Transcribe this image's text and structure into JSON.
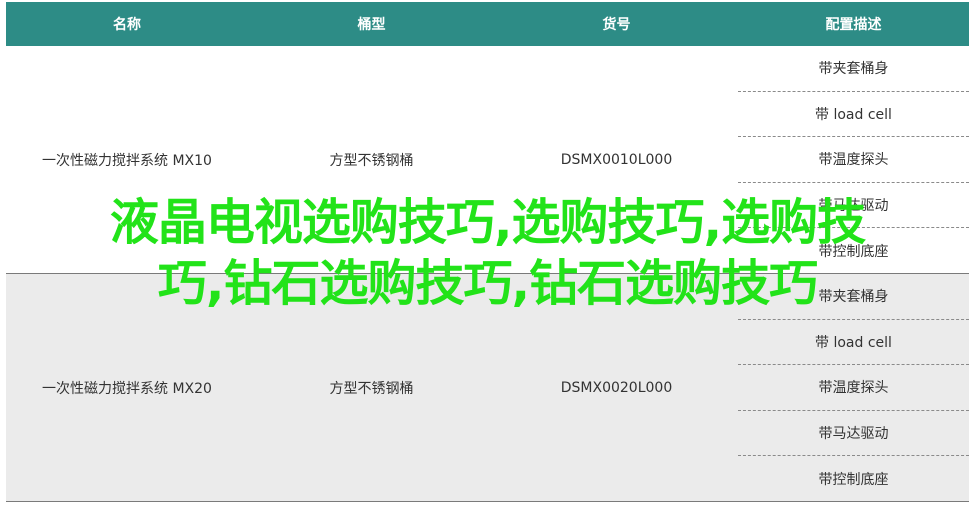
{
  "table": {
    "headers": [
      "名称",
      "桶型",
      "货号",
      "配置描述"
    ],
    "groups": [
      {
        "name": "一次性磁力搅拌系统 MX10",
        "barrel": "方型不锈钢桶",
        "sku": "DSMX0010L000",
        "configs": [
          "带夹套桶身",
          "带 load cell",
          "带温度探头",
          "带马达驱动",
          "带控制底座"
        ]
      },
      {
        "name": "一次性磁力搅拌系统 MX20",
        "barrel": "方型不锈钢桶",
        "sku": "DSMX0020L000",
        "configs": [
          "带夹套桶身",
          "带 load cell",
          "带温度探头",
          "带马达驱动",
          "带控制底座"
        ]
      }
    ]
  },
  "overlay": {
    "line1": "液晶电视选购技巧,选购技巧,选购技",
    "line2": "巧,钻石选购技巧,钻石选购技巧"
  }
}
